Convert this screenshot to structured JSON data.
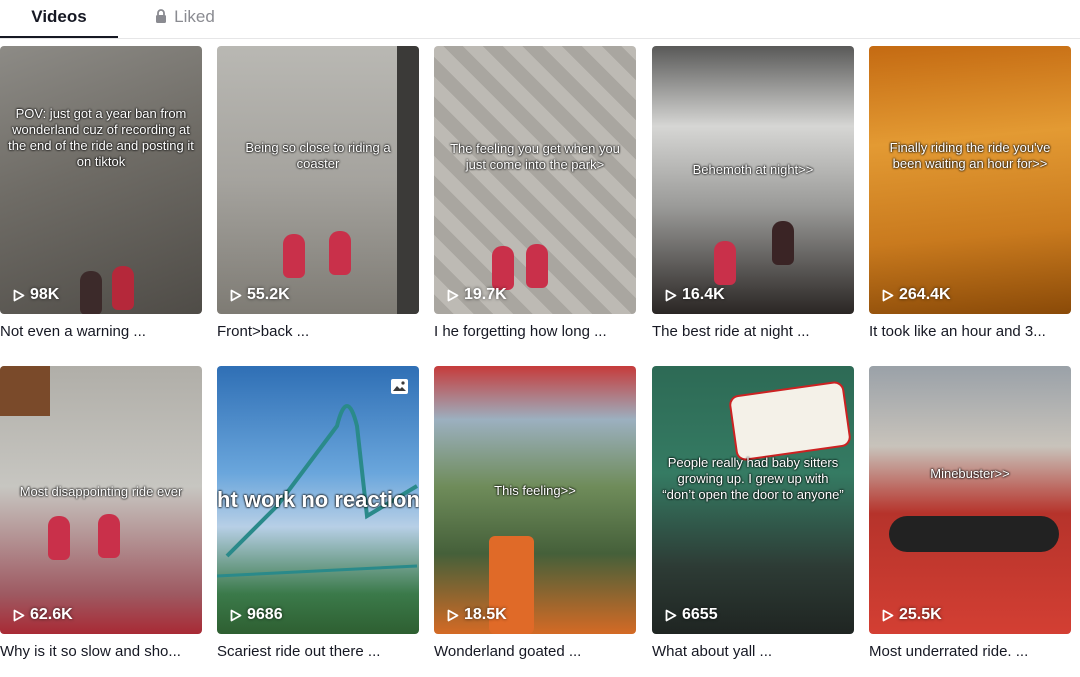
{
  "tabs": {
    "videos": "Videos",
    "liked": "Liked"
  },
  "videos": [
    {
      "views": "98K",
      "caption": "Not even a warning ...",
      "overlay": "POV: just got a year ban from wonderland cuz of recording at the end of the ride and posting it on tiktok",
      "bg": "linear-gradient(160deg,#8d8b86 0%,#6f6c66 45%,#4f4c47 100%)"
    },
    {
      "views": "55.2K",
      "caption": "Front>back ...",
      "overlay": "Being so close to riding a coaster",
      "bg": "linear-gradient(180deg,#b9b8b3 0%,#a5a39e 50%,#7e7b74 100%)"
    },
    {
      "views": "19.7K",
      "caption": "I he forgetting how long ...",
      "overlay": "The feeling you get when you just come into the park>",
      "bg": "repeating-linear-gradient(45deg,#a9a6a0 0 14px,#bdbab4 14px 28px)"
    },
    {
      "views": "16.4K",
      "caption": "The best ride at night ...",
      "overlay": "Behemoth at night>>",
      "bg": "linear-gradient(180deg,#595958 0%,#d6d6d4 30%,#9a9a98 60%,#2a2624 100%)"
    },
    {
      "views": "264.4K",
      "caption": "It took like an hour and 3...",
      "overlay": "Finally riding the ride you've been waiting an hour for>>",
      "bg": "linear-gradient(175deg,#c46a12 0%,#e39a33 35%,#c97a1e 70%,#8a4a08 100%)"
    },
    {
      "views": "62.6K",
      "caption": "Why is it so slow and sho...",
      "overlay": "Most disappointing ride ever",
      "bg": "linear-gradient(180deg,#b0aea8 0%,#c7c6c1 45%,#9e5a62 85%,#a82a35 100%)"
    },
    {
      "views": "9686",
      "caption": "Scariest ride out there ...",
      "overlay": "ht work no reaction",
      "bg": "linear-gradient(180deg,#2f6fb5 0%,#6aa6dc 40%,#b7cfe6 60%,#3b7a4a 85%,#2e5f31 100%)"
    },
    {
      "views": "18.5K",
      "caption": "Wonderland goated ...",
      "overlay": "This feeling>>",
      "bg": "linear-gradient(180deg,#c63b3b 0%,#9cb0c0 20%,#6f8c5a 45%,#45603a 70%,#d46a25 100%)"
    },
    {
      "views": "6655",
      "caption": "What about yall ...",
      "overlay": "People really had baby sitters growing up. I grew up with “don’t open the door to anyone”",
      "bg": "linear-gradient(180deg,#2d6a55 0%,#357b63 40%,#2d3b35 75%,#1f2522 100%)"
    },
    {
      "views": "25.5K",
      "caption": "Most underrated ride. ...",
      "overlay": "Minebuster>>",
      "bg": "linear-gradient(180deg,#9aa1a8 0%,#c8c3bb 30%,#b6332b 55%,#d33f33 100%)"
    }
  ],
  "icons": {
    "lock": "lock-icon",
    "play": "play-icon",
    "photo": "photo-icon"
  }
}
